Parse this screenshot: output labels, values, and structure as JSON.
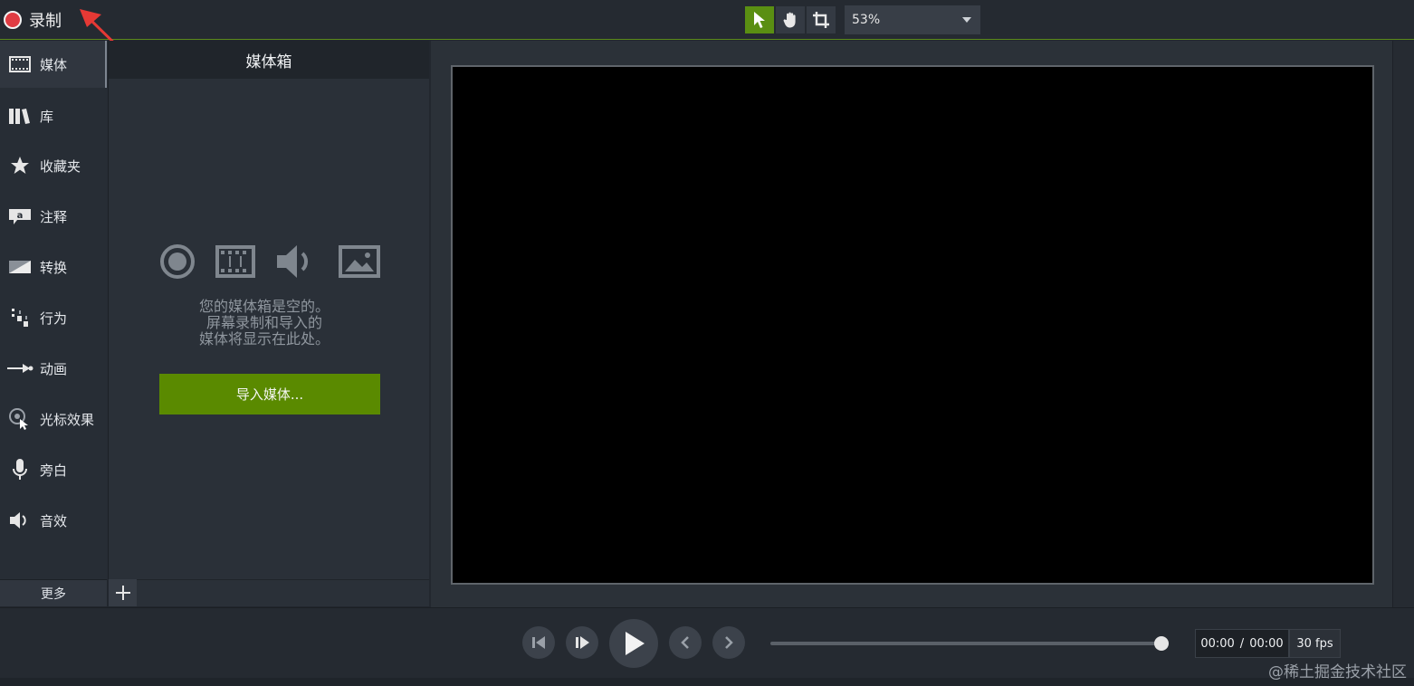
{
  "topbar": {
    "record_label": "录制",
    "zoom_value": "53%",
    "tools": [
      {
        "name": "select-tool",
        "icon": "arrow-cursor-icon",
        "active": true
      },
      {
        "name": "pan-tool",
        "icon": "hand-icon",
        "active": false
      },
      {
        "name": "crop-tool",
        "icon": "crop-icon",
        "active": false
      }
    ]
  },
  "sidebar": {
    "items": [
      {
        "label": "媒体",
        "icon": "film-icon"
      },
      {
        "label": "库",
        "icon": "library-icon"
      },
      {
        "label": "收藏夹",
        "icon": "star-icon"
      },
      {
        "label": "注释",
        "icon": "annotation-icon"
      },
      {
        "label": "转换",
        "icon": "transition-icon"
      },
      {
        "label": "行为",
        "icon": "behavior-icon"
      },
      {
        "label": "动画",
        "icon": "animation-icon"
      },
      {
        "label": "光标效果",
        "icon": "cursor-effect-icon"
      },
      {
        "label": "旁白",
        "icon": "microphone-icon"
      },
      {
        "label": "音效",
        "icon": "speaker-icon"
      }
    ],
    "more_label": "更多"
  },
  "media_panel": {
    "title": "媒体箱",
    "empty_lines": [
      "您的媒体箱是空的。",
      "屏幕录制和导入的",
      "媒体将显示在此处。"
    ],
    "import_label": "导入媒体..."
  },
  "transport": {
    "time_current": "00:00",
    "time_separator": "/",
    "time_total": "00:00",
    "fps_label": "30 fps",
    "playhead_fraction": 1.0
  },
  "watermark": "@稀土掘金技术社区",
  "colors": {
    "accent_green": "#5a8a00",
    "record_red": "#e03c43",
    "annotation_arrow": "#e53935"
  }
}
